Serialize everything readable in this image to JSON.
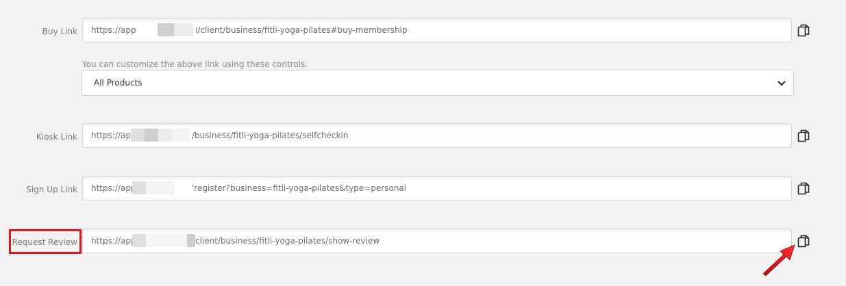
{
  "buy": {
    "label": "Buy Link",
    "url_start": "https://app",
    "url_end": "ı/client/business/fitli-yoga-pilates#buy-membership"
  },
  "customize": {
    "hint": "You can customize the above link using these controls.",
    "selected": "All Products"
  },
  "kiosk": {
    "label": "Kiosk Link",
    "url_start": "https://app",
    "url_end": "/business/fitli-yoga-pilates/selfcheckin"
  },
  "signup": {
    "label": "Sign Up Link",
    "url_start": "https://app",
    "url_end": "'register?business=fitli-yoga-pilates&type=personal"
  },
  "review": {
    "label": "Request Review",
    "url_start": "https://app",
    "url_end": "client/business/fitli-yoga-pilates/show-review"
  },
  "colors": {
    "highlight": "#e8131a",
    "background": "#f2f2f2"
  },
  "icons": {
    "copy": "copy-icon",
    "dropdown": "chevron-down-icon",
    "annotation": "red-arrow"
  }
}
